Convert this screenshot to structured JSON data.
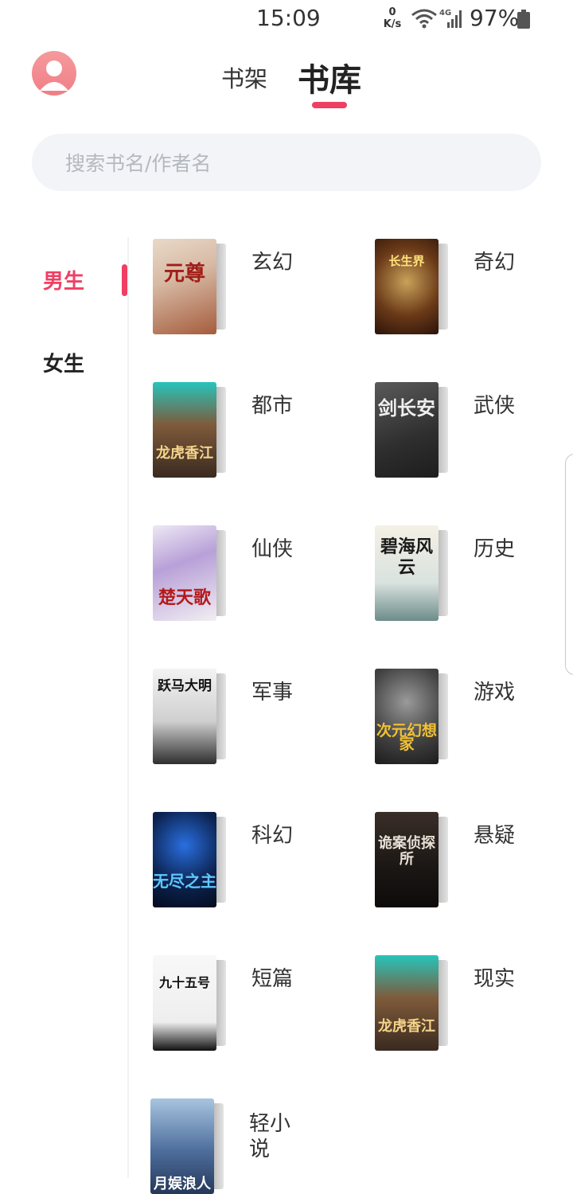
{
  "status_bar": {
    "time": "15:09",
    "net_speed_value": "0",
    "net_speed_unit": "K/s",
    "network": "4G",
    "battery": "97%"
  },
  "header": {
    "tabs": [
      {
        "label": "书架",
        "active": false
      },
      {
        "label": "书库",
        "active": true
      }
    ],
    "accent_color": "#ef3f63"
  },
  "search": {
    "placeholder": "搜索书名/作者名",
    "value": ""
  },
  "gender_tabs": [
    {
      "label": "男生",
      "active": true
    },
    {
      "label": "女生",
      "active": false
    }
  ],
  "categories": [
    {
      "label": "玄幻",
      "cover_title": "元尊"
    },
    {
      "label": "奇幻",
      "cover_title": "长生界"
    },
    {
      "label": "都市",
      "cover_title": "龙虎香江"
    },
    {
      "label": "武侠",
      "cover_title": "剑长安"
    },
    {
      "label": "仙侠",
      "cover_title": "楚天歌"
    },
    {
      "label": "历史",
      "cover_title": "碧海风云"
    },
    {
      "label": "军事",
      "cover_title": "跃马大明"
    },
    {
      "label": "游戏",
      "cover_title": "次元幻想家"
    },
    {
      "label": "科幻",
      "cover_title": "无尽之主"
    },
    {
      "label": "悬疑",
      "cover_title": "诡案侦探所"
    },
    {
      "label": "短篇",
      "cover_title": "九十五号"
    },
    {
      "label": "现实",
      "cover_title": "龙虎香江"
    },
    {
      "label": "轻小说",
      "cover_title": "月娱浪人"
    }
  ]
}
